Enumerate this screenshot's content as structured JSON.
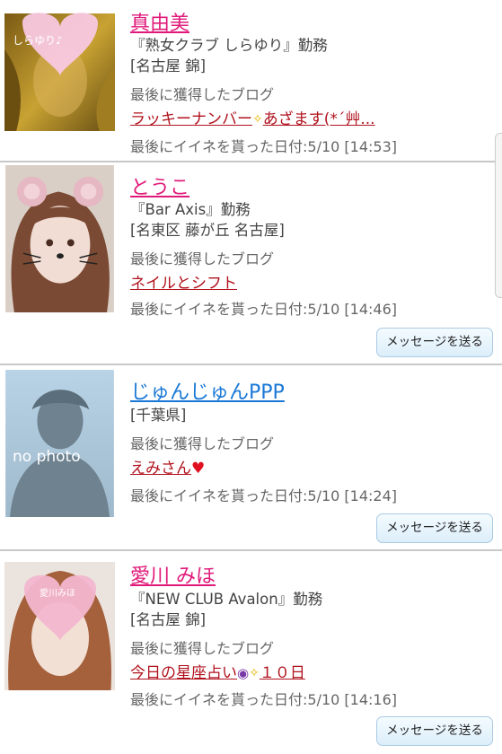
{
  "cards": [
    {
      "name": "真由美",
      "shop": "『熟女クラブ しらゆり』勤務",
      "area": "[名古屋 錦]",
      "blog_label": "最後に獲得したブログ",
      "blog_title_a": "ラッキーナンバー",
      "blog_title_b": "あざます(*´艸...",
      "date_line": "最後にイイネを貰った日付:5/10 [14:53]",
      "thumb_text": "しらゆり♪"
    },
    {
      "name": "とうこ",
      "shop": "『Bar Axis』勤務",
      "area": "[名東区 藤が丘 名古屋]",
      "blog_label": "最後に獲得したブログ",
      "blog_title": "ネイルとシフト",
      "date_line": "最後にイイネを貰った日付:5/10 [14:46]",
      "button": "メッセージを送る"
    },
    {
      "name": "じゅんじゅんPPP",
      "area": "[千葉県]",
      "blog_label": "最後に獲得したブログ",
      "blog_title": "えみさん",
      "date_line": "最後にイイネを貰った日付:5/10 [14:24]",
      "button": "メッセージを送る",
      "thumb_text": "no photo"
    },
    {
      "name": "愛川 みほ",
      "shop": "『NEW CLUB Avalon』勤務",
      "area": "[名古屋 錦]",
      "blog_label": "最後に獲得したブログ",
      "blog_title_a": "今日の星座占い",
      "blog_title_b": "１０日",
      "date_line": "最後にイイネを貰った日付:5/10 [14:16]",
      "button": "メッセージを送る",
      "thumb_text": "愛川みほ"
    }
  ],
  "colors": {
    "name_pink": "#e01a7a",
    "name_blue": "#1a78d6",
    "blog_red": "#b0121d",
    "divider": "#c8c8c8"
  }
}
